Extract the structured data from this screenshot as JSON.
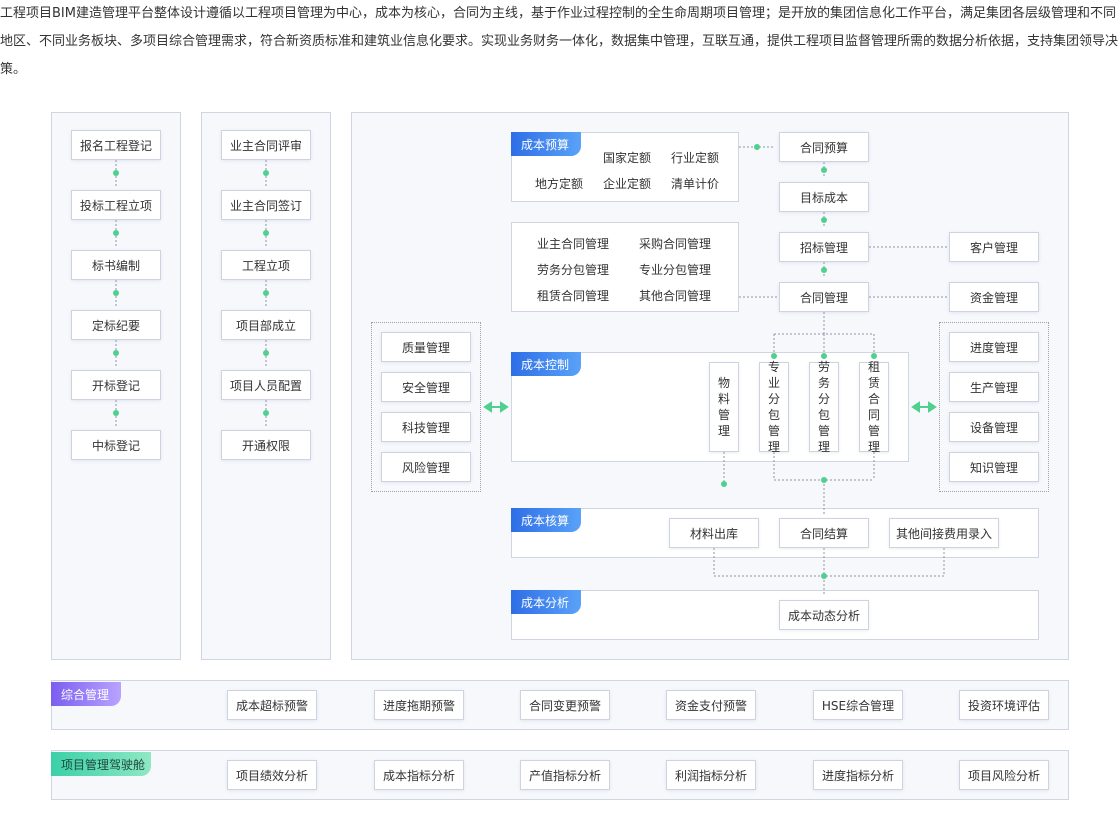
{
  "intro": "工程项目BIM建造管理平台整体设计遵循以工程项目管理为中心，成本为核心，合同为主线，基于作业过程控制的全生命周期项目管理；是开放的集团信息化工作平台，满足集团各层级管理和不同地区、不同业务板块、多项目综合管理需求，符合新资质标准和建筑业信息化要求。实现业务财务一体化，数据集中管理，互联互通，提供工程项目监督管理所需的数据分析依据，支持集团领导决策。",
  "col1": [
    "报名工程登记",
    "投标工程立项",
    "标书编制",
    "定标纪要",
    "开标登记",
    "中标登记"
  ],
  "col2": [
    "业主合同评审",
    "业主合同签订",
    "工程立项",
    "项目部成立",
    "项目人员配置",
    "开通权限"
  ],
  "budget": {
    "tag": "成本预算",
    "items": [
      "国家定额",
      "行业定额",
      "地方定额",
      "企业定额",
      "清单计价"
    ]
  },
  "contract_types": [
    "业主合同管理",
    "采购合同管理",
    "劳务分包管理",
    "专业分包管理",
    "租赁合同管理",
    "其他合同管理"
  ],
  "flow": {
    "contract_budget": "合同预算",
    "target_cost": "目标成本",
    "bidding": "招标管理",
    "contract_mgmt": "合同管理"
  },
  "right_top": {
    "customer": "客户管理",
    "funds": "资金管理"
  },
  "left_group": [
    "质量管理",
    "安全管理",
    "科技管理",
    "风险管理"
  ],
  "right_group": [
    "进度管理",
    "生产管理",
    "设备管理",
    "知识管理"
  ],
  "control": {
    "tag": "成本控制",
    "items": [
      "物料管理",
      "专业分包管理",
      "劳务分包管理",
      "租赁合同管理"
    ]
  },
  "accounting": {
    "tag": "成本核算",
    "items": [
      "材料出库",
      "合同结算",
      "其他间接费用录入"
    ]
  },
  "analysis": {
    "tag": "成本分析",
    "item": "成本动态分析"
  },
  "comprehensive": {
    "tag": "综合管理",
    "items": [
      "成本超标预警",
      "进度拖期预警",
      "合同变更预警",
      "资金支付预警",
      "HSE综合管理",
      "投资环境评估"
    ]
  },
  "cockpit": {
    "tag": "项目管理驾驶舱",
    "items": [
      "项目绩效分析",
      "成本指标分析",
      "产值指标分析",
      "利润指标分析",
      "进度指标分析",
      "项目风险分析"
    ]
  },
  "colors": {
    "connector": "#4fd08f",
    "dashed": "#8a96a8",
    "tag_blue": "#2e6ee6",
    "tag_purple": "#7b5ef0",
    "tag_green": "#3ad0a8"
  }
}
